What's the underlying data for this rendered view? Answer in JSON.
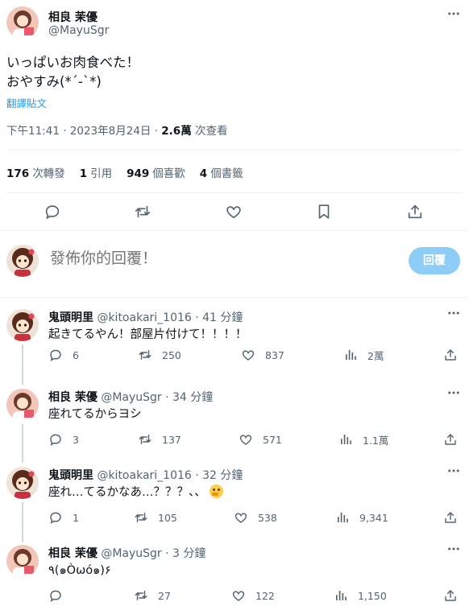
{
  "main_tweet": {
    "author_name": "相良 茉優",
    "author_handle": "@MayuSgr",
    "text": "いっぱいお肉食べた！\nおやすみ(*´-`*)",
    "translate_label": "翻譯貼文",
    "timestamp": "下午11:41 · 2023年8月24日 · ",
    "views_count": "2.6萬",
    "views_label": " 次查看",
    "stats": {
      "retweets_count": "176",
      "retweets_label": "次轉發",
      "quotes_count": "1",
      "quotes_label": "引用",
      "likes_count": "949",
      "likes_label": "個喜歡",
      "bookmarks_count": "4",
      "bookmarks_label": "個書籤"
    }
  },
  "compose": {
    "placeholder": "發佈你的回覆！",
    "reply_button": "回覆"
  },
  "replies": [
    {
      "name": "鬼頭明里",
      "handle_time": " @kitoakari_1016 · 41 分鐘",
      "text": "起きてるやん！部屋片付けて！！！！",
      "replies": "6",
      "retweets": "250",
      "likes": "837",
      "views": "2萬"
    },
    {
      "name": "相良 茉優",
      "handle_time": " @MayuSgr · 34 分鐘",
      "text": "座れてるからヨシ",
      "replies": "3",
      "retweets": "137",
      "likes": "571",
      "views": "1.1萬"
    },
    {
      "name": "鬼頭明里",
      "handle_time": " @kitoakari_1016 · 32 分鐘",
      "text": "座れ…てるかなあ…？？？、、",
      "replies": "1",
      "retweets": "105",
      "likes": "538",
      "views": "9,341"
    },
    {
      "name": "相良 茉優",
      "handle_time": " @MayuSgr · 3 分鐘",
      "text": "٩(๑Òωó๑)۶",
      "replies": "",
      "retweets": "27",
      "likes": "122",
      "views": "1,150"
    }
  ],
  "colors": {
    "accent": "#1d9bf0",
    "reply_button_disabled": "#8ecdf8",
    "secondary_text": "#536471",
    "divider": "#eff3f4"
  },
  "icons": [
    "more-icon",
    "reply-icon",
    "retweet-icon",
    "like-icon",
    "bookmark-icon",
    "share-icon",
    "views-icon"
  ]
}
